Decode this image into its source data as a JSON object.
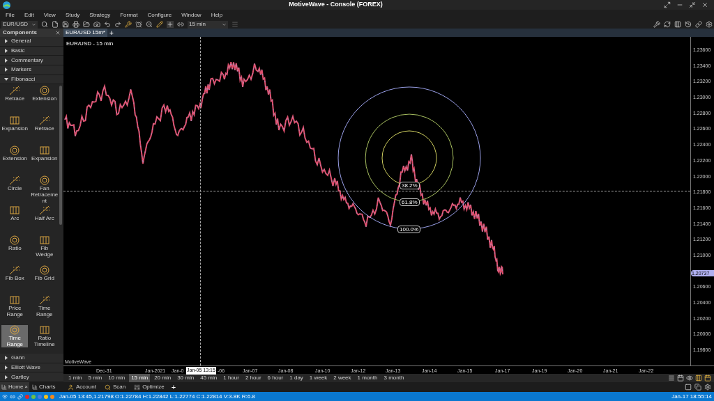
{
  "window": {
    "title": "MotiveWave - Console (FOREX)"
  },
  "menu": [
    "File",
    "Edit",
    "View",
    "Study",
    "Strategy",
    "Format",
    "Configure",
    "Window",
    "Help"
  ],
  "toolbar": {
    "symbol": "EUR/USD",
    "timeframe": "15 min"
  },
  "sidebar": {
    "title": "Components",
    "groups": [
      {
        "label": "General",
        "expanded": false
      },
      {
        "label": "Basic",
        "expanded": false
      },
      {
        "label": "Commentary",
        "expanded": false
      },
      {
        "label": "Markers",
        "expanded": false
      },
      {
        "label": "Fibonacci",
        "expanded": true,
        "tools": [
          {
            "label": "Retrace",
            "selected": false
          },
          {
            "label": "Extension",
            "selected": false
          },
          {
            "label": "Expansion",
            "selected": false
          },
          {
            "label": "Retrace",
            "selected": false
          },
          {
            "label": "Extension",
            "selected": false
          },
          {
            "label": "Expansion",
            "selected": false
          },
          {
            "label": "Circle",
            "selected": false
          },
          {
            "label": "Fan Retraceme nt",
            "selected": false
          },
          {
            "label": "Arc",
            "selected": false
          },
          {
            "label": "Half Arc",
            "selected": false
          },
          {
            "label": "Ratio",
            "selected": false
          },
          {
            "label": "Fib Wedge",
            "selected": false
          },
          {
            "label": "Fib Box",
            "selected": false
          },
          {
            "label": "Fib Grid",
            "selected": false
          },
          {
            "label": "Price Range",
            "selected": false
          },
          {
            "label": "Time Range",
            "selected": false
          },
          {
            "label": "Time Range",
            "selected": true
          },
          {
            "label": "Ratio Timeline",
            "selected": false
          }
        ]
      },
      {
        "label": "Gann",
        "expanded": false
      },
      {
        "label": "Elliott Wave",
        "expanded": false
      },
      {
        "label": "Gartley",
        "expanded": false
      }
    ]
  },
  "chart_tab": {
    "label": "EUR/USD 15m*",
    "add": "+"
  },
  "chart": {
    "title": "EUR/USD - 15 min",
    "brand": "MotiveWave",
    "upper_ticks": [
      "1.23600",
      "1.23400",
      "1.23200",
      "1.23000",
      "1.22800",
      "1.22600",
      "1.22400",
      "1.22200",
      "1.22000",
      "1.21800",
      "1.21600",
      "1.21400",
      "1.21200",
      "1.21000"
    ],
    "current_price": "1.20737",
    "lower_ticks": [
      "1.20600",
      "1.20400",
      "1.20200",
      "1.20000",
      "1.19800"
    ],
    "x_labels": [
      "Dec-31",
      "Jan-2021",
      "Jan-0",
      "-06",
      "Jan-07",
      "Jan-08",
      "Jan-10",
      "Jan-12",
      "Jan-13",
      "Jan-14",
      "Jan-15",
      "Jan-17",
      "Jan-19",
      "Jan-20",
      "Jan-21",
      "Jan-22"
    ],
    "crosshair_time": "Jan-05 13:15",
    "fib_levels": [
      "38.2%",
      "61.8%",
      "100.0%"
    ]
  },
  "timeframes": [
    {
      "label": "1 min",
      "selected": false
    },
    {
      "label": "5 min",
      "selected": false
    },
    {
      "label": "10 min",
      "selected": false
    },
    {
      "label": "15 min",
      "selected": true
    },
    {
      "label": "20 min",
      "selected": false
    },
    {
      "label": "30 min",
      "selected": false
    },
    {
      "label": "45 min",
      "selected": false
    },
    {
      "label": "1 hour",
      "selected": false
    },
    {
      "label": "2 hour",
      "selected": false
    },
    {
      "label": "6 hour",
      "selected": false
    },
    {
      "label": "1 day",
      "selected": false
    },
    {
      "label": "1 week",
      "selected": false
    },
    {
      "label": "2 week",
      "selected": false
    },
    {
      "label": "1 month",
      "selected": false
    },
    {
      "label": "3 month",
      "selected": false
    }
  ],
  "bottom_tabs": [
    {
      "label": "Home",
      "selected": true,
      "close": "×"
    },
    {
      "label": "Charts",
      "selected": false
    }
  ],
  "workspace_tabs": [
    "Account",
    "Scan",
    "Optimize"
  ],
  "add_tab": "+",
  "status": {
    "dots": [
      {
        "color": "#e02828"
      },
      {
        "color": "#6cbf4a"
      },
      {
        "color": "#4a78e0"
      },
      {
        "color": "#f0c020"
      },
      {
        "color": "#f08a20"
      }
    ],
    "text": "Jan-05 13:45,1.21798 O:1.22784 H:1.22842 L:1.22774 C:1.22814 V:3.8K R:6.8",
    "clock": "Jan-17 18:55:14"
  }
}
